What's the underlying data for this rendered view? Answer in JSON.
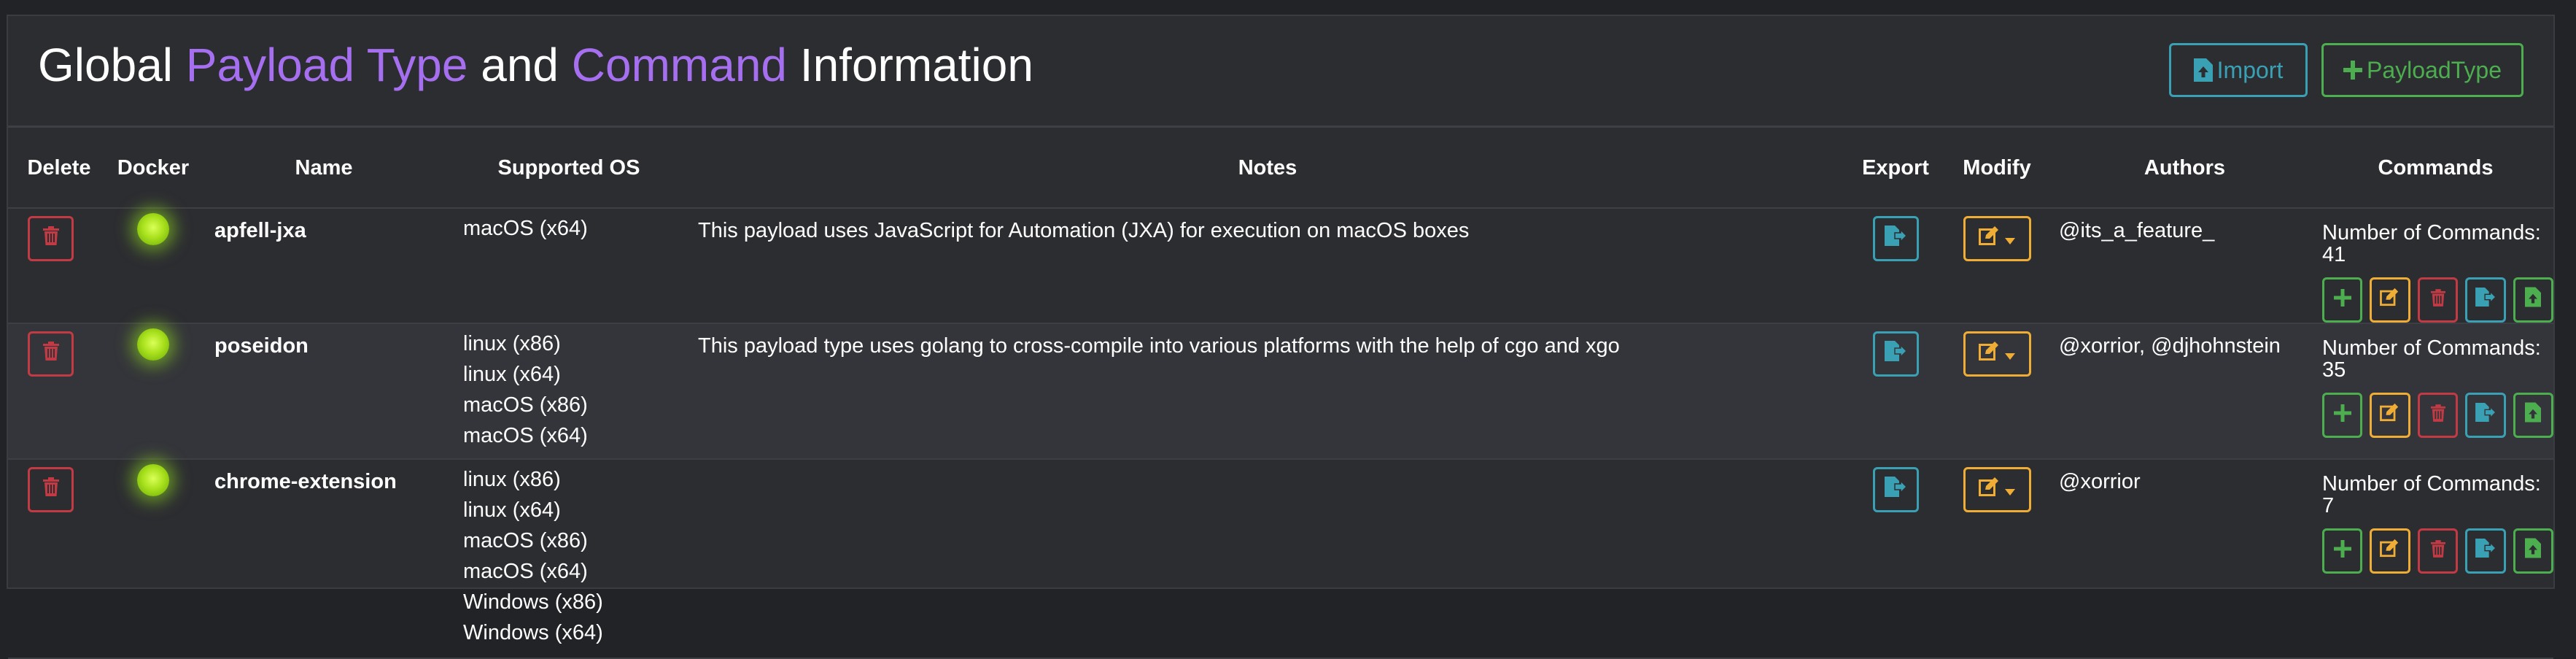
{
  "header": {
    "title_parts": [
      "Global ",
      "Payload Type",
      " and ",
      "Command",
      " Information"
    ],
    "import_label": "Import",
    "payloadtype_label": "PayloadType"
  },
  "table": {
    "columns": [
      "Delete",
      "Docker",
      "Name",
      "Supported OS",
      "Notes",
      "Export",
      "Modify",
      "Authors",
      "Commands"
    ],
    "rows": [
      {
        "name": "apfell-jxa",
        "os": [
          "macOS (x64)"
        ],
        "notes": "This payload uses JavaScript for Automation (JXA) for execution on macOS boxes",
        "authors": "@its_a_feature_",
        "commands": "Number of Commands: 41",
        "docker_status": "online"
      },
      {
        "name": "poseidon",
        "os": [
          "linux (x86)",
          "linux (x64)",
          "macOS (x86)",
          "macOS (x64)"
        ],
        "notes": "This payload type uses golang to cross-compile into various platforms with the help of cgo and xgo",
        "authors": "@xorrior, @djhohnstein",
        "commands": "Number of Commands: 35",
        "docker_status": "online"
      },
      {
        "name": "chrome-extension",
        "os": [
          "linux (x86)",
          "linux (x64)",
          "macOS (x86)",
          "macOS (x64)",
          "Windows (x86)",
          "Windows (x64)"
        ],
        "notes": "",
        "authors": "@xorrior",
        "commands": "Number of Commands: 7",
        "docker_status": "online"
      }
    ]
  },
  "colors": {
    "accent_purple": "#a56ff0",
    "green": "#4cae4f",
    "yellow": "#f0ad35",
    "red": "#c23a44",
    "blue": "#3aa0b4",
    "docker_led": "#a8e01c"
  },
  "icons": {
    "delete": "trash-icon",
    "export": "file-export-icon",
    "modify": "edit-icon",
    "import": "file-upload-icon",
    "add": "plus-icon"
  }
}
